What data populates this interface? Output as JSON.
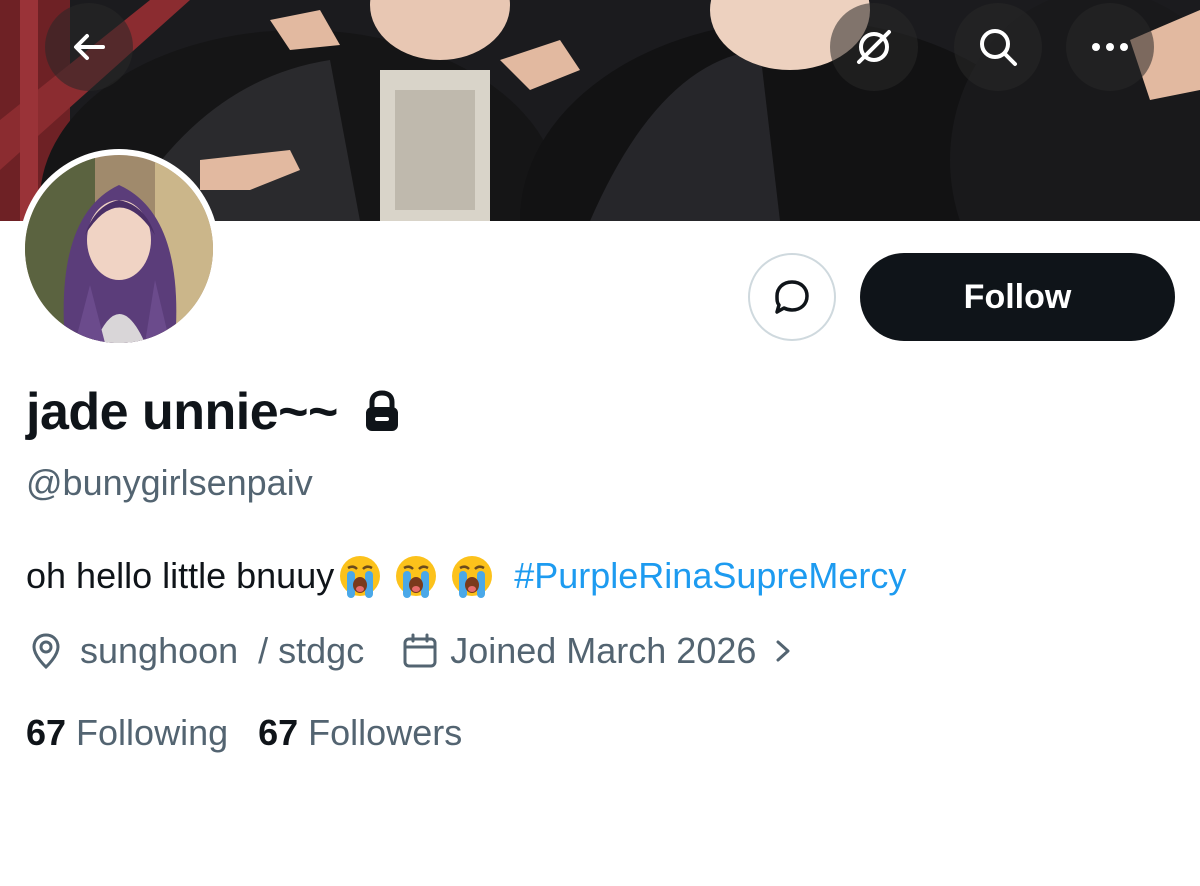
{
  "header": {
    "back_icon": "arrow-left-icon",
    "grok_icon": "slashed-circle-icon",
    "search_icon": "search-icon",
    "more_icon": "more-dots-icon"
  },
  "profile": {
    "display_name": "jade unnie~~",
    "protected_icon": "lock-icon",
    "handle": "@bunygirlsenpaiv",
    "bio_text": "oh hello little bnuuy",
    "bio_emoji": [
      "loudly-crying-face",
      "loudly-crying-face",
      "loudly-crying-face"
    ],
    "bio_hashtag": "#PurpleRinaSupreMercy",
    "location": "sunghoon  / stdgc",
    "joined": "Joined March 2026",
    "following_count": "67",
    "following_label": "Following",
    "followers_count": "67",
    "followers_label": "Followers"
  },
  "actions": {
    "message_icon": "message-bubble-icon",
    "follow_label": "Follow"
  },
  "colors": {
    "link": "#1d9bf0",
    "secondary_text": "#536471",
    "primary_text": "#0f1419",
    "follow_bg": "#0f1419"
  }
}
